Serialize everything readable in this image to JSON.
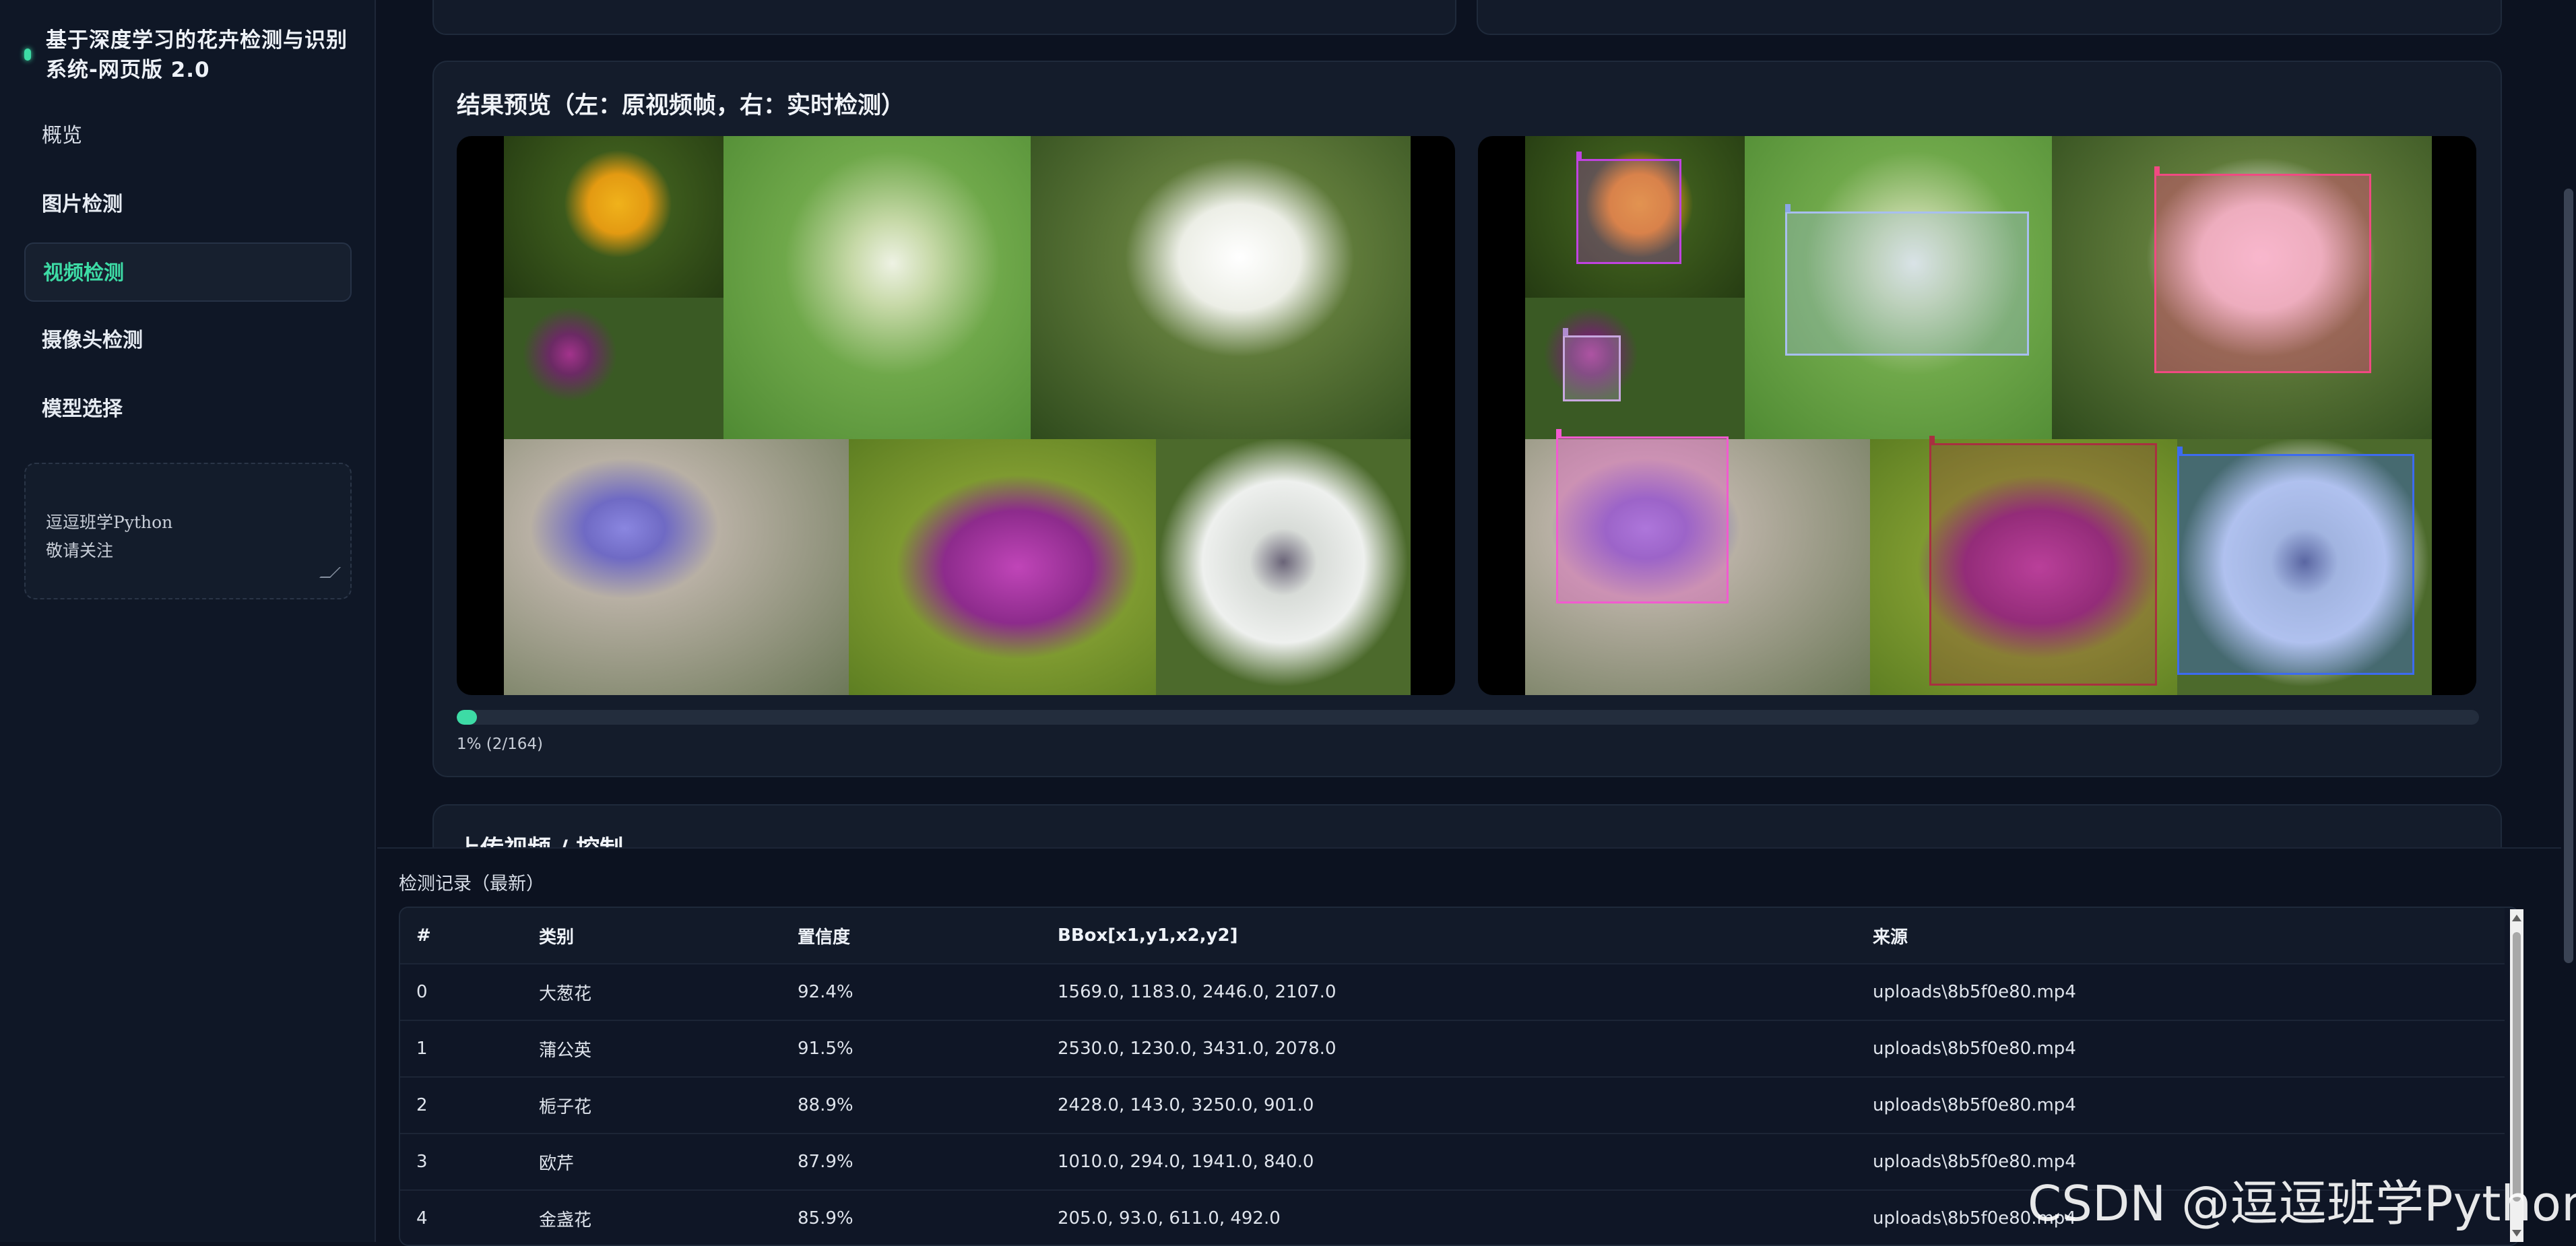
{
  "sidebar": {
    "brand_title": "基于深度学习的花卉检测与识别系统-网页版 2.0",
    "nav": [
      {
        "label": "概览"
      },
      {
        "label": "图片检测"
      },
      {
        "label": "视频检测"
      },
      {
        "label": "摄像头检测"
      },
      {
        "label": "模型选择"
      }
    ],
    "active_index": 2,
    "notes_text": "逗逗班学Python\n敬请关注"
  },
  "preview": {
    "title": "结果预览（左：原视频帧，右：实时检测）",
    "progress_fraction": 0.01,
    "progress_text": "1% (2/164)"
  },
  "upload": {
    "title": "上传视频 / 控制"
  },
  "records": {
    "title": "检测记录（最新）",
    "columns": [
      "#",
      "类别",
      "置信度",
      "BBox[x1,y1,x2,y2]",
      "来源"
    ],
    "rows": [
      [
        "0",
        "大葱花",
        "92.4%",
        "1569.0, 1183.0, 2446.0, 2107.0",
        "uploads\\8b5f0e80.mp4"
      ],
      [
        "1",
        "蒲公英",
        "91.5%",
        "2530.0, 1230.0, 3431.0, 2078.0",
        "uploads\\8b5f0e80.mp4"
      ],
      [
        "2",
        "栀子花",
        "88.9%",
        "2428.0, 143.0, 3250.0, 901.0",
        "uploads\\8b5f0e80.mp4"
      ],
      [
        "3",
        "欧芹",
        "87.9%",
        "1010.0, 294.0, 1941.0, 840.0",
        "uploads\\8b5f0e80.mp4"
      ],
      [
        "4",
        "金盏花",
        "85.9%",
        "205.0, 93.0, 611.0, 492.0",
        "uploads\\8b5f0e80.mp4"
      ]
    ]
  },
  "watermark": "CSDN @逗逗班学Python",
  "colors": {
    "accent": "#3ddba5",
    "background": "#0c1220",
    "panel": "#141c2b"
  }
}
